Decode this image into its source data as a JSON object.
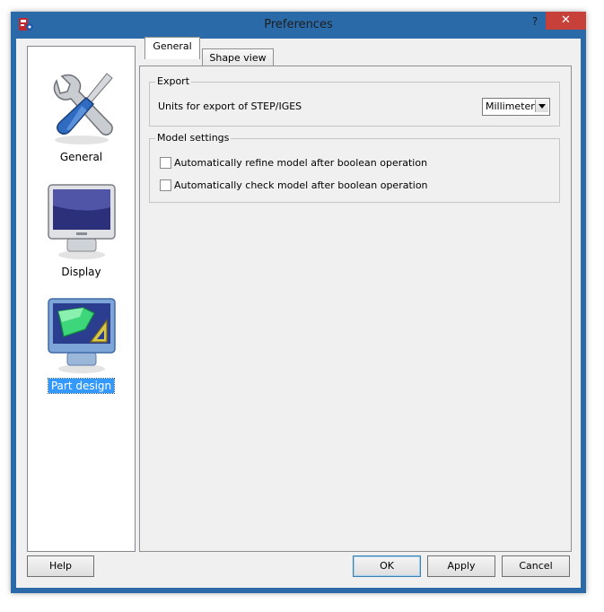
{
  "window": {
    "title": "Preferences",
    "help_glyph": "?",
    "close_glyph": "✕",
    "accent": "#2b6aa8",
    "close_color": "#c7403a"
  },
  "categories": [
    {
      "label": "General",
      "icon": "wrench-screwdriver-icon",
      "selected": false
    },
    {
      "label": "Display",
      "icon": "monitor-icon",
      "selected": false
    },
    {
      "label": "Part design",
      "icon": "part-design-monitor-icon",
      "selected": true
    }
  ],
  "tabs": [
    {
      "label": "General",
      "active": true
    },
    {
      "label": "Shape view",
      "active": false
    }
  ],
  "export": {
    "title": "Export",
    "units_label": "Units for export of STEP/IGES",
    "units_value": "Millimeter"
  },
  "model_settings": {
    "title": "Model settings",
    "options": [
      {
        "label": "Automatically refine model after boolean operation",
        "checked": false
      },
      {
        "label": "Automatically check model after boolean operation",
        "checked": false
      }
    ]
  },
  "buttons": {
    "help": "Help",
    "ok": "OK",
    "apply": "Apply",
    "cancel": "Cancel"
  }
}
